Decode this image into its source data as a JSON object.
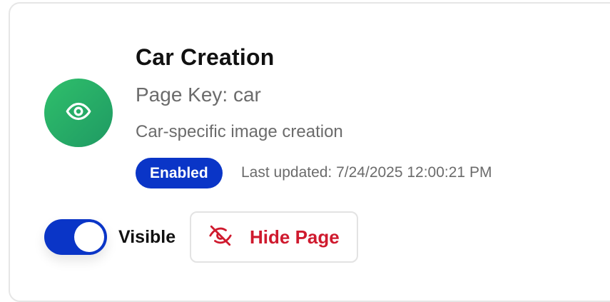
{
  "card": {
    "title": "Car Creation",
    "page_key": "Page Key: car",
    "description": "Car-specific image creation",
    "status_badge": "Enabled",
    "last_updated": "Last updated: 7/24/2025 12:00:21 PM"
  },
  "controls": {
    "visibility_toggle": {
      "label": "Visible",
      "on": true
    },
    "hide_button": {
      "label": "Hide Page",
      "icon": "eye-off-icon"
    }
  },
  "icons": {
    "avatar": "eye-icon"
  },
  "colors": {
    "accent": "#0a35c7",
    "avatar_green": "#27b065",
    "danger": "#cf1a2e",
    "muted_text": "#6b6b6b"
  }
}
